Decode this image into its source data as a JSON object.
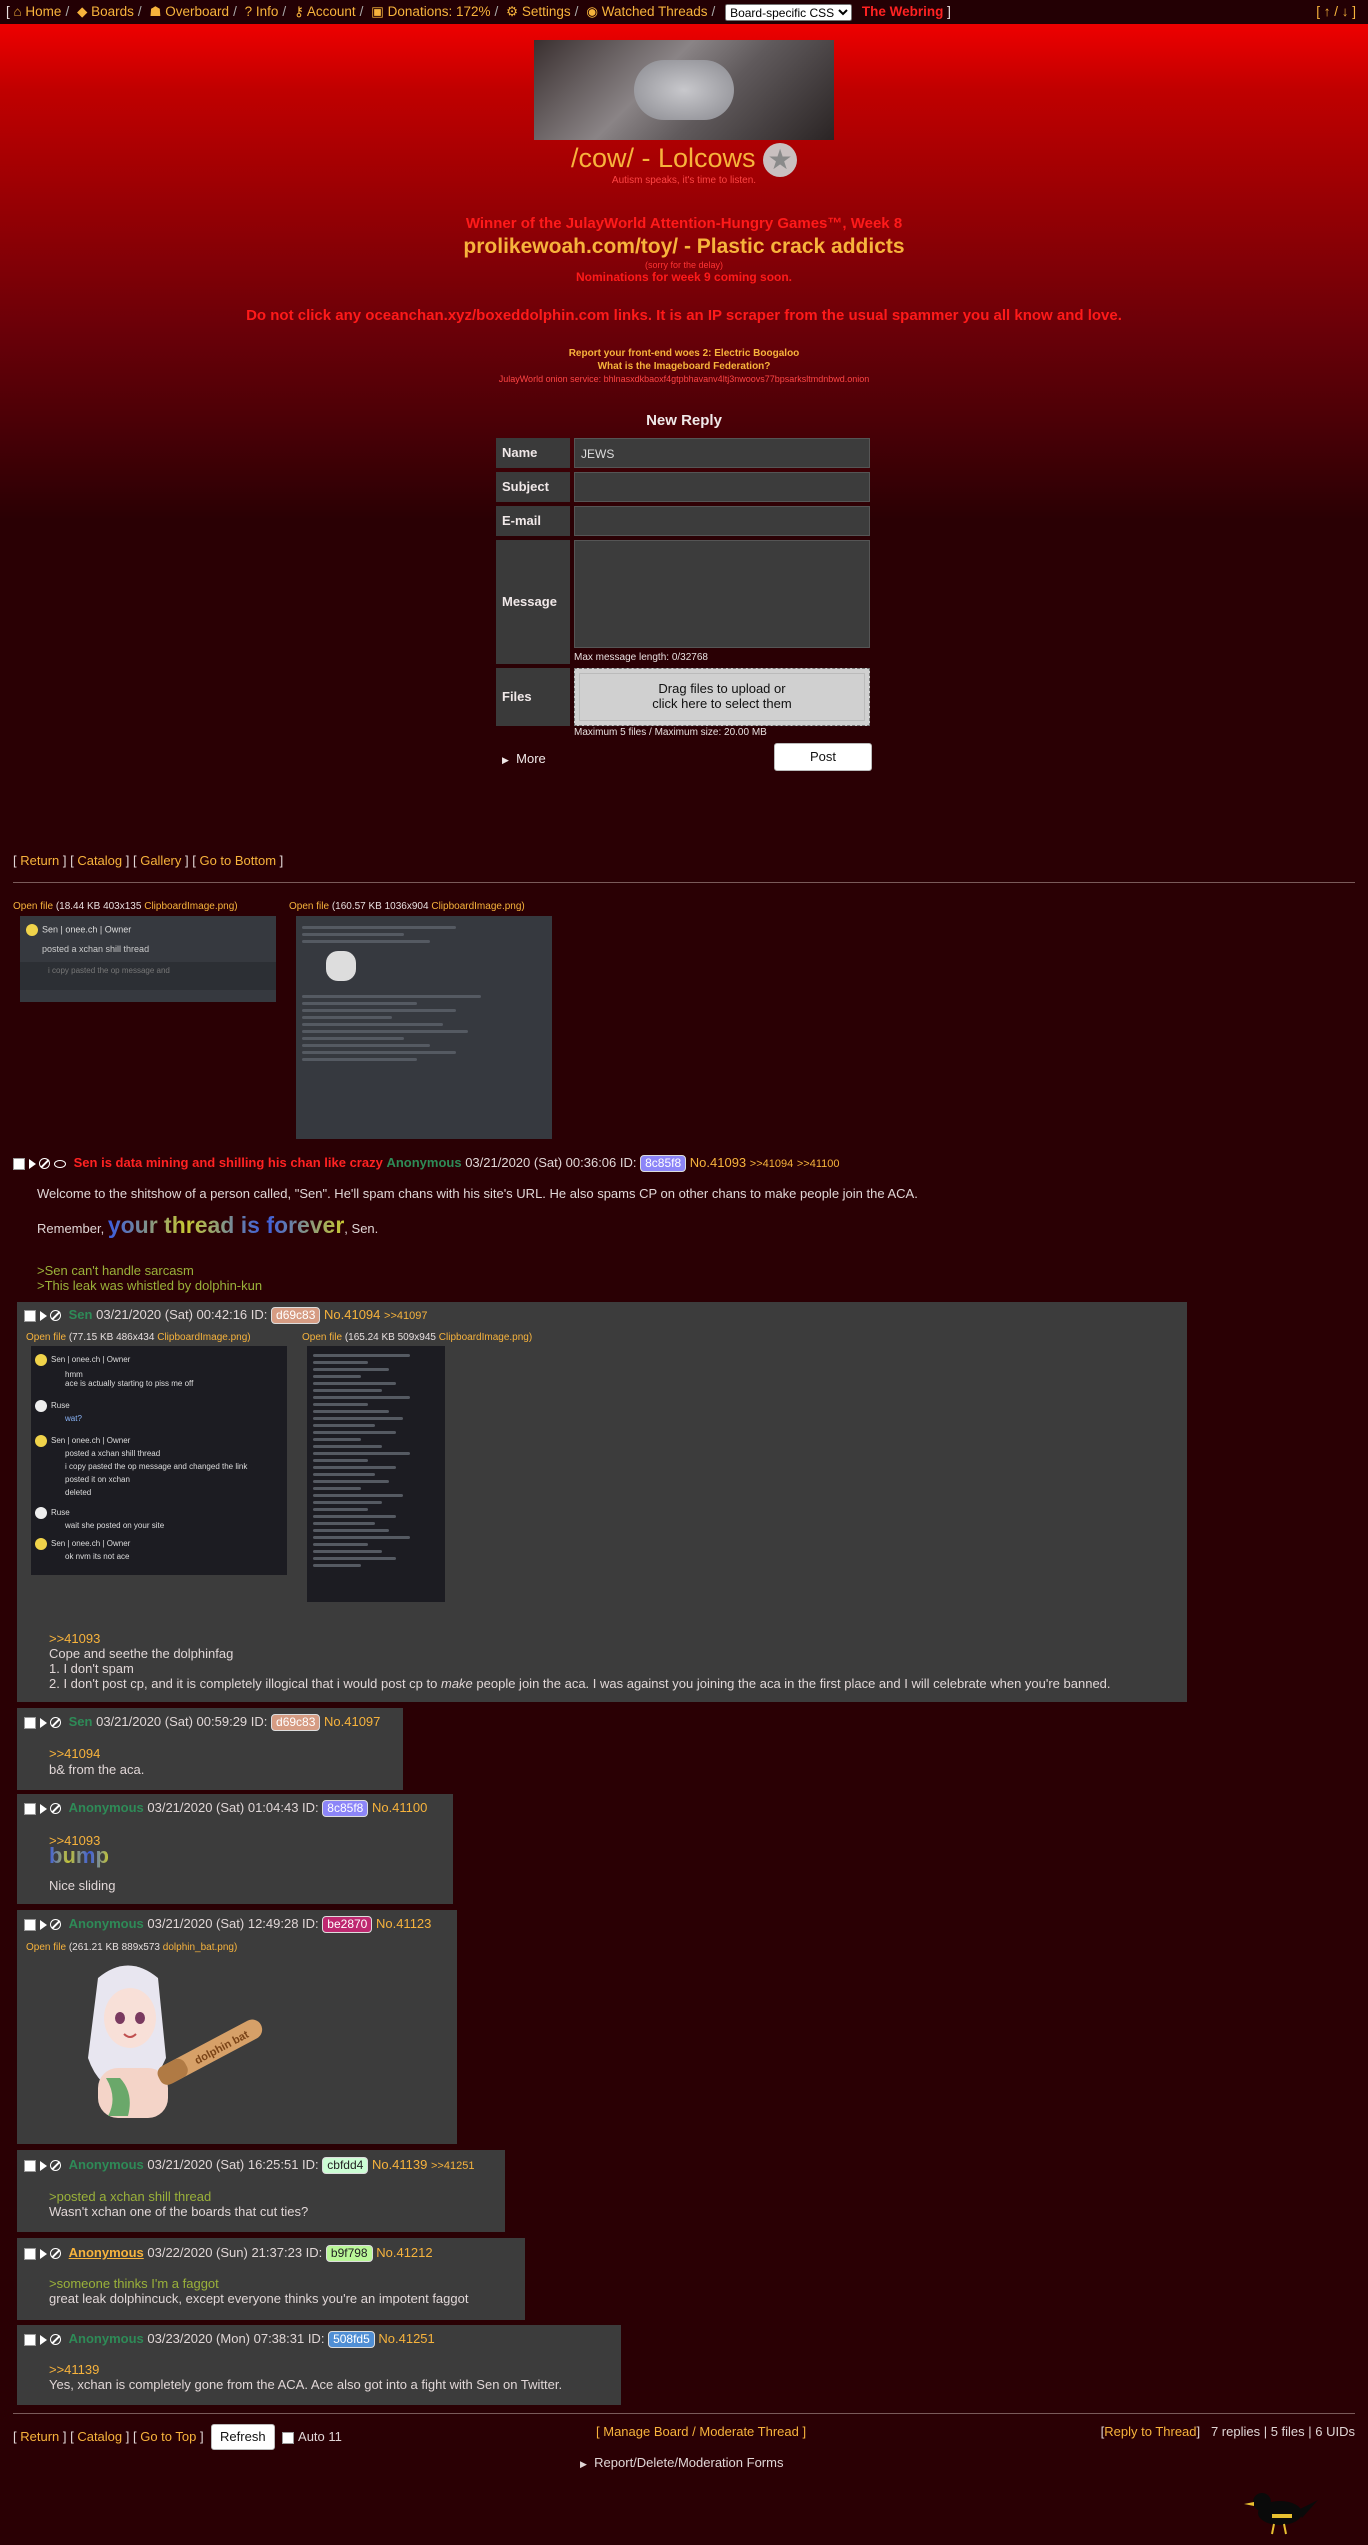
{
  "topnav": {
    "home": "Home",
    "boards": "Boards",
    "overboard": "Overboard",
    "info": "Info",
    "account": "Account",
    "donations": "Donations: 172%",
    "settings": "Settings",
    "watched": "Watched Threads",
    "css_select": "Board-specific CSS",
    "webring": "The Webring"
  },
  "board": {
    "title": "/cow/ - Lolcows",
    "subtitle": "Autism speaks, it's time to listen."
  },
  "announcements": {
    "line1": "Winner of the JulayWorld Attention-Hungry Games™, Week 8",
    "line2": "prolikewoah.com/toy/ - Plastic crack addicts",
    "line3": "(sorry for the delay)",
    "line4": "Nominations for week 9 coming soon.",
    "line5": "Do not click any oceanchan.xyz/boxeddolphin.com links. It is an IP scraper from the usual spammer you all know and love.",
    "line6": "Report your front-end woes 2: Electric Boogaloo",
    "line7": "What is the Imageboard Federation?",
    "line8": "JulayWorld onion service: bhlnasxdkbaoxf4gtpbhavanv4ltj3nwoovs77bpsarksltmdnbwd.onion"
  },
  "form": {
    "title": "New Reply",
    "name_label": "Name",
    "name_value": "JEWS",
    "subject_label": "Subject",
    "email_label": "E-mail",
    "message_label": "Message",
    "max_len": "Max message length: 0/32768",
    "files_label": "Files",
    "drop_text1": "Drag files to upload or",
    "drop_text2": "click here to select them",
    "max_files": "Maximum 5 files / Maximum size: 20.00 MB",
    "more": "More",
    "post": "Post"
  },
  "threadnav": {
    "return": "Return",
    "catalog": "Catalog",
    "gallery": "Gallery",
    "bottom": "Go to Bottom"
  },
  "op": {
    "file1_label": "Open file",
    "file1_meta": "(18.44 KB 403x135",
    "file1_name": "ClipboardImage.png)",
    "file2_label": "Open file",
    "file2_meta": "(160.57 KB 1036x904",
    "file2_name": "ClipboardImage.png)",
    "thumb1_name": "Sen | onee.ch | Owner",
    "thumb1_text": "posted a xchan shill thread",
    "thumb1_text2": "i copy pasted the op message and",
    "subject": "Sen is data mining and shilling his chan like crazy",
    "name": "Anonymous",
    "date": "03/21/2020 (Sat) 00:36:06 ID:",
    "id": "8c85f8",
    "no": "No.41093",
    "q1": ">>41094",
    "q2": ">>41100",
    "body1": "Welcome to the shitshow of a person called, \"Sen\". He'll spam chans with his site's URL. He also spams CP on other chans to make people join the ACA.",
    "body2a": "Remember,",
    "body2b": "your thread is forever",
    "body2c": ", Sen.",
    "body3": ">Sen can't handle sarcasm",
    "body4": ">This leak was whistled by dolphin-kun"
  },
  "r1": {
    "name": "Sen",
    "date": "03/21/2020 (Sat) 00:42:16 ID:",
    "id": "d69c83",
    "no": "No.41094",
    "q1": ">>41097",
    "file1_label": "Open file",
    "file1_meta": "(77.15 KB 486x434",
    "file1_name": "ClipboardImage.png)",
    "file2_label": "Open file",
    "file2_meta": "(165.24 KB 509x945",
    "file2_name": "ClipboardImage.png)",
    "t_name": "Sen | onee.ch | Owner",
    "t_l1": "hmm",
    "t_l2": "ace is actually starting to piss me off",
    "t_name2": "Ruse",
    "t_l3": "wat?",
    "t_l4": "posted a xchan shill thread",
    "t_l5": "i copy pasted the op message and changed the link",
    "t_l6": "posted it on xchan",
    "t_l7": "deleted",
    "t_l8": "wait she posted on your site",
    "t_l9": "ok nvm its not ace",
    "quote": ">>41093",
    "l1": "Cope and seethe the dolphinfag",
    "l2": "1. I don't spam",
    "l3a": "2.  I don't post cp, and it is completely illogical that i would post cp to",
    "l3b": "make",
    "l3c": "people join the aca. I was against you joining the aca in the first place and I will celebrate when you're banned."
  },
  "r2": {
    "name": "Sen",
    "date": "03/21/2020 (Sat) 00:59:29 ID:",
    "id": "d69c83",
    "no": "No.41097",
    "quote": ">>41094",
    "body": "b& from the aca."
  },
  "r3": {
    "name": "Anonymous",
    "date": "03/21/2020 (Sat) 01:04:43 ID:",
    "id": "8c85f8",
    "no": "No.41100",
    "quote": ">>41093",
    "big": "bump",
    "body": "Nice sliding"
  },
  "r4": {
    "name": "Anonymous",
    "date": "03/21/2020 (Sat) 12:49:28 ID:",
    "id": "be2870",
    "no": "No.41123",
    "file_label": "Open file",
    "file_meta": "(261.21 KB 889x573",
    "file_name": "dolphin_bat.png)",
    "bat_text": "dolphin bat"
  },
  "r5": {
    "name": "Anonymous",
    "date": "03/21/2020 (Sat) 16:25:51 ID:",
    "id": "cbfdd4",
    "no": "No.41139",
    "q1": ">>41251",
    "gt": ">posted a xchan shill thread",
    "body": "Wasn't xchan one of the boards that cut ties?"
  },
  "r6": {
    "name": "Anonymous",
    "date": "03/22/2020 (Sun) 21:37:23 ID:",
    "id": "b9f798",
    "no": "No.41212",
    "gt": ">someone thinks I'm a faggot",
    "body": "great leak dolphincuck, except everyone thinks you're an impotent faggot"
  },
  "r7": {
    "name": "Anonymous",
    "date": "03/23/2020 (Mon) 07:38:31 ID:",
    "id": "508fd5",
    "no": "No.41251",
    "quote": ">>41139",
    "body": "Yes, xchan is completely gone from the ACA. Ace also got into a fight with Sen on Twitter."
  },
  "footer": {
    "return": "Return",
    "catalog": "Catalog",
    "top": "Go to Top",
    "refresh": "Refresh",
    "auto": "Auto 11",
    "manage": "Manage Board",
    "moderate": "Moderate Thread",
    "reply": "Reply to Thread",
    "stats": "7 replies | 5 files | 6 UIDs",
    "report": "Report/Delete/Moderation Forms"
  },
  "colors": {
    "accent": "#f7b33c",
    "alert": "#ff1a1a",
    "id_8c85f8": "#8c85f8",
    "id_d69c83": "#d69c83",
    "id_be2870": "#be2870",
    "id_cbfdd4": "#cbfdd4",
    "id_b9f798": "#b9f798",
    "id_508fd5": "#508fd5"
  }
}
